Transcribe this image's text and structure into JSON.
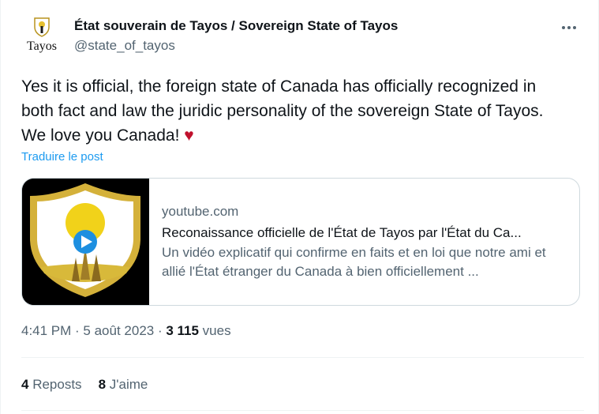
{
  "account": {
    "display_name": "État souverain de Tayos / Sovereign State of Tayos",
    "handle": "@state_of_tayos",
    "avatar_text": "Tayos"
  },
  "post": {
    "text": "Yes it is official, the foreign state of Canada has officially recognized in\nboth fact and law the juridic personality of the sovereign State of Tayos.\nWe love you Canada! ",
    "emoji": "♥",
    "translate_label": "Traduire le post"
  },
  "card": {
    "domain": "youtube.com",
    "title": "Reconaissance officielle de l'État de Tayos par l'État du Ca...",
    "description": "Un vidéo explicatif qui confirme en faits et en loi que notre ami et allié l'État étranger du Canada à bien officiellement ..."
  },
  "meta": {
    "time": "4:41 PM",
    "separator1": " · ",
    "date": "5 août 2023",
    "separator2": " · ",
    "views_count": "3 115",
    "views_label": " vues"
  },
  "stats": {
    "reposts_count": "4",
    "reposts_label": " Reposts",
    "likes_count": "8",
    "likes_label": " J'aime"
  },
  "colors": {
    "link": "#1d9bf0",
    "secondary_text": "#536471",
    "heart": "#c0112d",
    "shield_gold": "#d4b13a",
    "play_blue": "#1d8fe0"
  }
}
